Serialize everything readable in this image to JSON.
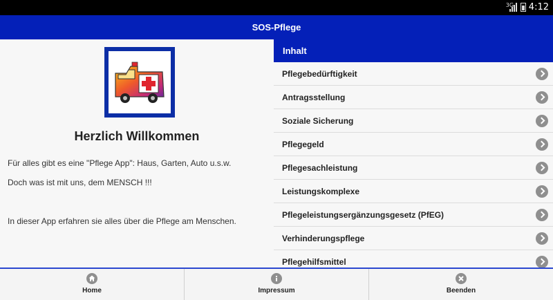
{
  "status_bar": {
    "network": "3G",
    "time": "4:12"
  },
  "app_bar": {
    "title": "SOS-Pflege"
  },
  "welcome": {
    "heading": "Herzlich Willkommen",
    "line1": "Für alles gibt es eine \"Pflege App\": Haus, Garten, Auto u.s.w.",
    "line2": "Doch was ist mit uns, dem MENSCH !!!",
    "line3": "In dieser App erfahren sie alles über die Pflege am Menschen."
  },
  "contents": {
    "header": "Inhalt",
    "items": [
      {
        "label": "Pflegebedürftigkeit"
      },
      {
        "label": "Antragsstellung"
      },
      {
        "label": "Soziale Sicherung"
      },
      {
        "label": "Pflegegeld"
      },
      {
        "label": "Pflegesachleistung"
      },
      {
        "label": "Leistungskomplexe"
      },
      {
        "label": "Pflegeleistungsergänzungsgesetz (PfEG)"
      },
      {
        "label": "Verhinderungspflege"
      },
      {
        "label": "Pflegehilfsmittel"
      }
    ]
  },
  "nav": {
    "home": {
      "label": "Home",
      "icon": "home-icon"
    },
    "impressum": {
      "label": "Impressum",
      "icon": "info-icon"
    },
    "beenden": {
      "label": "Beenden",
      "icon": "close-icon"
    }
  },
  "colors": {
    "primary": "#0420b8",
    "accent_line": "#2a47d0"
  }
}
